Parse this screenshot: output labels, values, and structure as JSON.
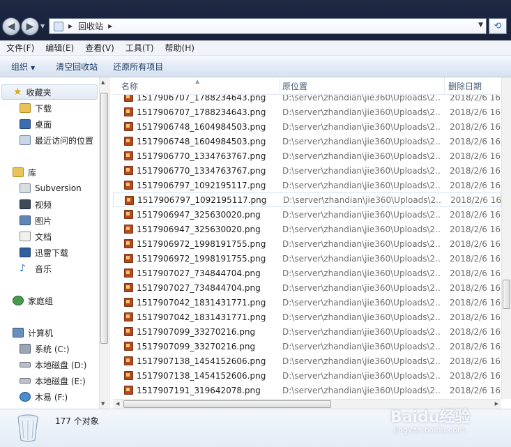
{
  "address": {
    "location": "回收站"
  },
  "menu": [
    "文件(F)",
    "编辑(E)",
    "查看(V)",
    "工具(T)",
    "帮助(H)"
  ],
  "commands": {
    "organize": "组织",
    "empty": "清空回收站",
    "restore": "还原所有项目"
  },
  "nav": {
    "favorites": "收藏夹",
    "downloads": "下载",
    "desktop": "桌面",
    "recent": "最近访问的位置",
    "libraries": "库",
    "subversion": "Subversion",
    "videos": "视频",
    "pictures": "图片",
    "documents": "文档",
    "thunder": "迅雷下载",
    "music": "音乐",
    "homegroup": "家庭组",
    "computer": "计算机",
    "drive_c": "系统 (C:)",
    "drive_d": "本地磁盘 (D:)",
    "drive_e": "本地磁盘 (E:)",
    "drive_f": "木易 (F:)"
  },
  "columns": {
    "name": "名称",
    "location": "原位置",
    "date": "删除日期"
  },
  "files": [
    {
      "name": "1517906707_1788234643.png",
      "location": "D:\\server\\zhandian\\jie360\\Uploads\\2...",
      "date": "2018/2/6 16:"
    },
    {
      "name": "1517906707_1788234643.png",
      "location": "D:\\server\\zhandian\\jie360\\Uploads\\2...",
      "date": "2018/2/6 16:"
    },
    {
      "name": "1517906748_1604984503.png",
      "location": "D:\\server\\zhandian\\jie360\\Uploads\\2...",
      "date": "2018/2/6 16:"
    },
    {
      "name": "1517906748_1604984503.png",
      "location": "D:\\server\\zhandian\\jie360\\Uploads\\2...",
      "date": "2018/2/6 16:"
    },
    {
      "name": "1517906770_1334763767.png",
      "location": "D:\\server\\zhandian\\jie360\\Uploads\\2...",
      "date": "2018/2/6 16:"
    },
    {
      "name": "1517906770_1334763767.png",
      "location": "D:\\server\\zhandian\\jie360\\Uploads\\2...",
      "date": "2018/2/6 16:"
    },
    {
      "name": "1517906797_1092195117.png",
      "location": "D:\\server\\zhandian\\jie360\\Uploads\\2...",
      "date": "2018/2/6 16:"
    },
    {
      "name": "1517906797_1092195117.png",
      "location": "D:\\server\\zhandian\\jie360\\Uploads\\2...",
      "date": "2018/2/6 16:"
    },
    {
      "name": "1517906947_325630020.png",
      "location": "D:\\server\\zhandian\\jie360\\Uploads\\2...",
      "date": "2018/2/6 16:"
    },
    {
      "name": "1517906947_325630020.png",
      "location": "D:\\server\\zhandian\\jie360\\Uploads\\2...",
      "date": "2018/2/6 16:"
    },
    {
      "name": "1517906972_1998191755.png",
      "location": "D:\\server\\zhandian\\jie360\\Uploads\\2...",
      "date": "2018/2/6 16:"
    },
    {
      "name": "1517906972_1998191755.png",
      "location": "D:\\server\\zhandian\\jie360\\Uploads\\2...",
      "date": "2018/2/6 16:"
    },
    {
      "name": "1517907027_734844704.png",
      "location": "D:\\server\\zhandian\\jie360\\Uploads\\2...",
      "date": "2018/2/6 16:"
    },
    {
      "name": "1517907027_734844704.png",
      "location": "D:\\server\\zhandian\\jie360\\Uploads\\2...",
      "date": "2018/2/6 16:"
    },
    {
      "name": "1517907042_1831431771.png",
      "location": "D:\\server\\zhandian\\jie360\\Uploads\\2...",
      "date": "2018/2/6 16:"
    },
    {
      "name": "1517907042_1831431771.png",
      "location": "D:\\server\\zhandian\\jie360\\Uploads\\2...",
      "date": "2018/2/6 16:"
    },
    {
      "name": "1517907099_33270216.png",
      "location": "D:\\server\\zhandian\\jie360\\Uploads\\2...",
      "date": "2018/2/6 16:"
    },
    {
      "name": "1517907099_33270216.png",
      "location": "D:\\server\\zhandian\\jie360\\Uploads\\2...",
      "date": "2018/2/6 16:"
    },
    {
      "name": "1517907138_1454152606.png",
      "location": "D:\\server\\zhandian\\jie360\\Uploads\\2...",
      "date": "2018/2/6 16:"
    },
    {
      "name": "1517907138_1454152606.png",
      "location": "D:\\server\\zhandian\\jie360\\Uploads\\2...",
      "date": "2018/2/6 16:"
    },
    {
      "name": "1517907191_319642078.png",
      "location": "D:\\server\\zhandian\\jie360\\Uploads\\2...",
      "date": "2018/2/6 16:"
    }
  ],
  "status": {
    "count": "177 个对象"
  },
  "watermark": {
    "brand": "Baidu经验",
    "url": "jingyan.baidu.com"
  }
}
